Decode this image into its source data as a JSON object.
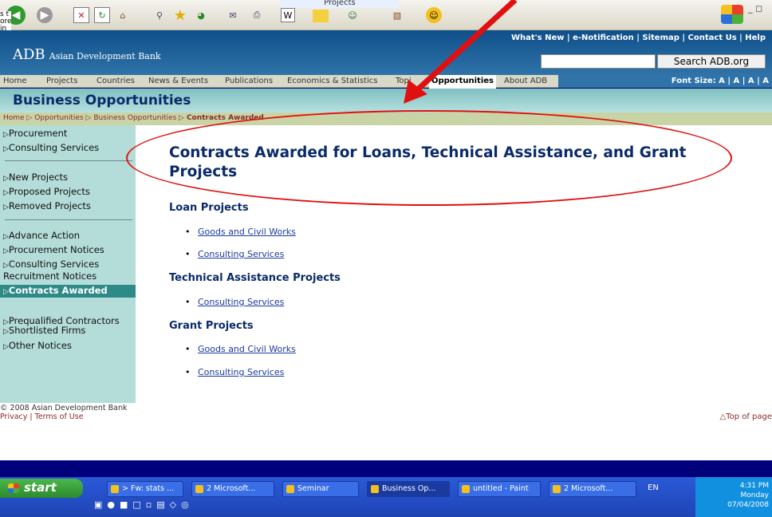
{
  "browser": {
    "tab_label": "Projects",
    "window_controls": "_ &#8722; &#1068;",
    "toolbar_icons": [
      "back-icon",
      "forward-icon",
      "stop-icon",
      "refresh-icon",
      "home-icon",
      "search-icon",
      "favorites-icon",
      "history-icon",
      "mail-icon",
      "print-icon",
      "edit-icon",
      "folder-icon",
      "messenger-icon",
      "research-icon",
      "smiley-icon"
    ]
  },
  "header": {
    "top_links": "What's New | e-Notification | Sitemap | Contact Us | Help",
    "logo_abbr": "ADB",
    "logo_text": "Asian Development Bank",
    "search_button": "Search ADB.org"
  },
  "nav": {
    "items": [
      "Home",
      "Projects",
      "Countries",
      "News & Events",
      "Publications",
      "Economics & Statistics",
      "Topi"
    ],
    "active": "Opportunities",
    "after": "About ADB",
    "font_size": "Font Size: A | A | A | A"
  },
  "section_title": "Business Opportunities",
  "breadcrumb": {
    "home": "Home",
    "opportunities": "Opportunities",
    "business": "Business Opportunities",
    "current": "Contracts Awarded"
  },
  "sidebar": {
    "items": [
      "Procurement",
      "Consulting Services",
      "New Projects",
      "Proposed Projects",
      "Removed Projects",
      "Advance Action",
      "Procurement Notices",
      "Consulting Services Recruitment Notices",
      "Contracts Awarded",
      "Prequalified Contractors",
      "Shortlisted Firms",
      "Other Notices"
    ]
  },
  "main": {
    "title": "Contracts Awarded for Loans, Technical Assistance, and Grant Projects",
    "loan_heading": "Loan Projects",
    "loan_links": [
      "Goods and Civil Works",
      "Consulting Services"
    ],
    "ta_heading": "Technical Assistance Projects",
    "ta_links": [
      "Consulting Services"
    ],
    "grant_heading": "Grant Projects",
    "grant_links": [
      "Goods and Civil Works",
      "Consulting Services"
    ]
  },
  "footer": {
    "copyright": "© 2008 Asian Development Bank",
    "privacy": "Privacy | Terms of Use",
    "top": "Top of page"
  },
  "taskbar": {
    "start": "start",
    "tasks": [
      "> Fw: stats ...",
      "2 Microsoft...",
      "Seminar",
      "Business Op...",
      "untitled - Paint",
      "2 Microsoft..."
    ],
    "lang": "EN",
    "time": "4:31 PM",
    "day": "Monday",
    "date": "07/04/2008"
  },
  "colors": {
    "annotation": "#e01010",
    "header": "#0f4f8a",
    "sidebar": "#b4dcd8"
  }
}
